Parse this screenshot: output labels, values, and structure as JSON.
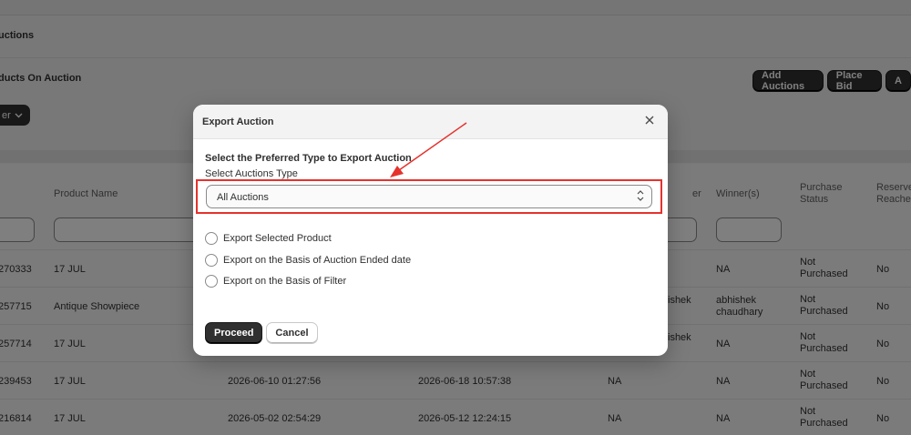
{
  "app": {
    "breadcrumb": "uctions",
    "section_title": "ducts On Auction",
    "actions": [
      "Add Auctions",
      "Place Bid",
      "A"
    ],
    "filter_button": "er"
  },
  "table": {
    "headers": {
      "product_name": "Product Name",
      "seller": "er",
      "winners": "Winner(s)",
      "purchase_status": "Purchase Status",
      "reserve": "Reserve Reached"
    },
    "rows": [
      {
        "id": "270333",
        "product": "17 JUL",
        "start": "",
        "end": "",
        "seller": "",
        "winner": "NA",
        "status": "Not Purchased",
        "reserve": "No"
      },
      {
        "id": "257715",
        "product": "Antique Showpiece",
        "start": "",
        "end": "",
        "seller": "ishek",
        "winner": "abhishek chaudhary",
        "status": "Not Purchased",
        "reserve": "No"
      },
      {
        "id": "257714",
        "product": "17 JUL",
        "start": "",
        "end": "",
        "seller": "ishek",
        "winner": "NA",
        "status": "Not Purchased",
        "reserve": "No"
      },
      {
        "id": "239453",
        "product": "17 JUL",
        "start": "2026-06-10 01:27:56",
        "end": "2026-06-18 10:57:38",
        "seller": "NA",
        "winner": "NA",
        "status": "Not Purchased",
        "reserve": "No"
      },
      {
        "id": "216814",
        "product": "17 JUL",
        "start": "2026-05-02 02:54:29",
        "end": "2026-05-12 12:24:15",
        "seller": "NA",
        "winner": "NA",
        "status": "Not Purchased",
        "reserve": "No"
      }
    ]
  },
  "modal": {
    "title": "Export Auction",
    "close_icon": "close-icon",
    "prompt": "Select the Preferred Type to Export Auction",
    "select_label": "Select Auctions Type",
    "select_value": "All Auctions",
    "options": [
      "Export Selected Product",
      "Export on the Basis of Auction Ended date",
      "Export on the Basis of Filter"
    ],
    "proceed_label": "Proceed",
    "cancel_label": "Cancel"
  },
  "colors": {
    "annotation": "#e5322d",
    "primary_button": "#303030"
  }
}
